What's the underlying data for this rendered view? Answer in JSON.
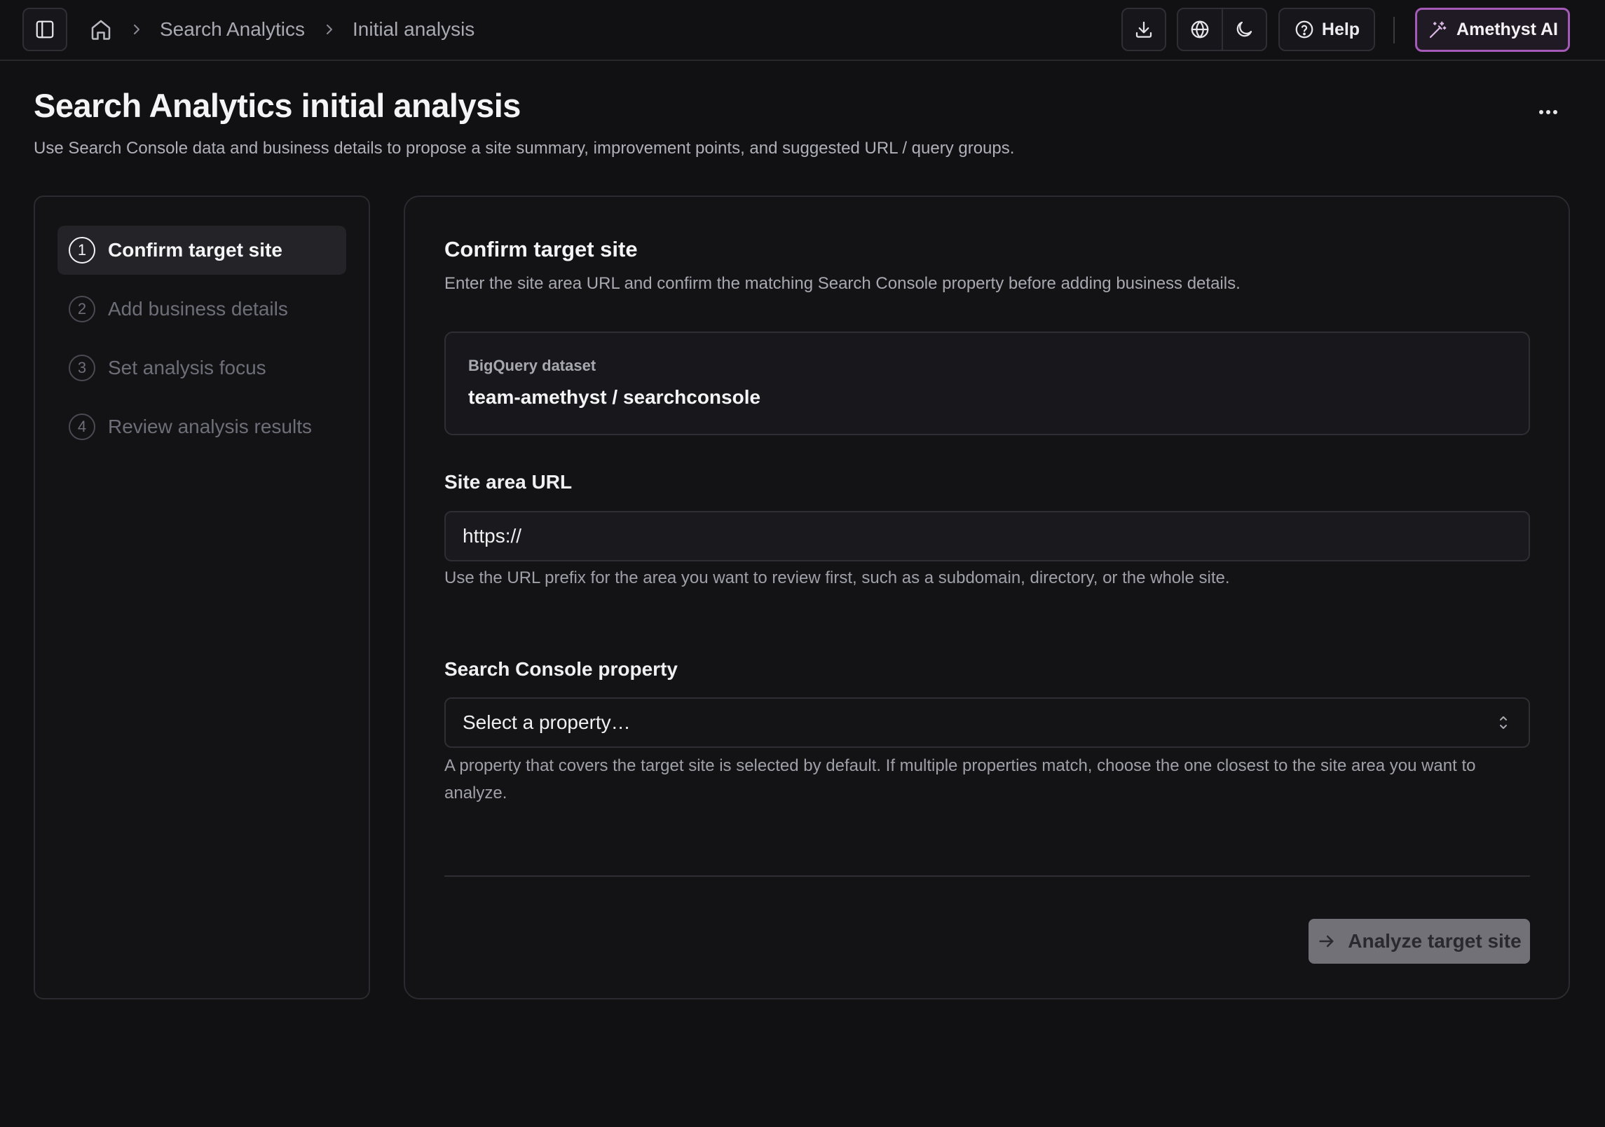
{
  "breadcrumb": {
    "items": [
      "Search Analytics",
      "Initial analysis"
    ]
  },
  "toolbar": {
    "help_label": "Help",
    "ai_label": "Amethyst AI"
  },
  "header": {
    "title": "Search Analytics initial analysis",
    "description": "Use Search Console data and business details to propose a site summary, improvement points, and suggested URL / query groups."
  },
  "steps": [
    {
      "number": "1",
      "label": "Confirm target site",
      "active": true
    },
    {
      "number": "2",
      "label": "Add business details",
      "active": false
    },
    {
      "number": "3",
      "label": "Set analysis focus",
      "active": false
    },
    {
      "number": "4",
      "label": "Review analysis results",
      "active": false
    }
  ],
  "card": {
    "title": "Confirm target site",
    "description": "Enter the site area URL and confirm the matching Search Console property before adding business details.",
    "dataset": {
      "label": "BigQuery dataset",
      "value": "team-amethyst / searchconsole"
    },
    "site_url": {
      "label": "Site area URL",
      "value": "https://",
      "hint": "Use the URL prefix for the area you want to review first, such as a subdomain, directory, or the whole site."
    },
    "property": {
      "label": "Search Console property",
      "selected": "Select a property…",
      "hint": "A property that covers the target site is selected by default. If multiple properties match, choose the one closest to the site area you want to analyze."
    },
    "submit_label": "Analyze target site"
  },
  "colors": {
    "background": "#111114",
    "ai_accent": "#a55ab8",
    "button_disabled": "#717177"
  }
}
